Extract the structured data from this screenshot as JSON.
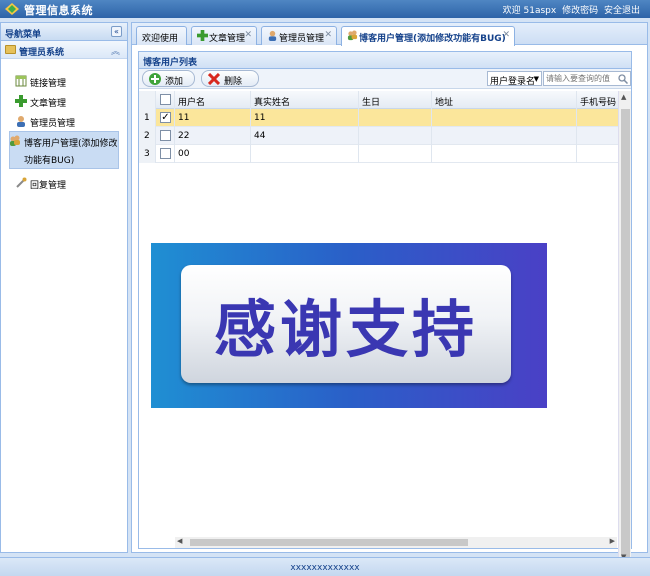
{
  "header": {
    "title": "管理信息系统",
    "welcome": "欢迎 51aspx",
    "change_password": "修改密码",
    "logout": "安全退出",
    "logo_icon": "app-logo-icon"
  },
  "sidebar": {
    "panel_title": "导航菜单",
    "group_title": "管理员系统",
    "items": [
      {
        "label": "链接管理",
        "icon": "link-grid-icon"
      },
      {
        "label": "文章管理",
        "icon": "green-plus-icon"
      },
      {
        "label": "管理员管理",
        "icon": "user-icon"
      },
      {
        "label": "博客用户管理(添加修改功能有BUG)",
        "icon": "users-icon"
      },
      {
        "label": "回复管理",
        "icon": "wrench-icon"
      }
    ]
  },
  "tabs": [
    {
      "label": "欢迎使用"
    },
    {
      "label": "文章管理"
    },
    {
      "label": "管理员管理"
    },
    {
      "label": "博客用户管理(添加修改功能有BUG)"
    }
  ],
  "grid": {
    "title": "博客用户列表",
    "add_label": "添加",
    "delete_label": "删除",
    "search_field": "用户登录名",
    "search_placeholder": "请输入要查询的值",
    "columns": [
      "用户名",
      "真实姓名",
      "生日",
      "地址",
      "手机号码"
    ],
    "rows": [
      {
        "num": "1",
        "checked": "✓",
        "username": "11",
        "realname": "11",
        "birthday": "",
        "address": "",
        "phone": ""
      },
      {
        "num": "2",
        "checked": "",
        "username": "22",
        "realname": "44",
        "birthday": "",
        "address": "",
        "phone": ""
      },
      {
        "num": "3",
        "checked": "",
        "username": "00",
        "realname": "",
        "birthday": "",
        "address": "",
        "phone": ""
      }
    ]
  },
  "banner": {
    "text": "感谢支持"
  },
  "footer": {
    "text": "xxxxxxxxxxxxx"
  },
  "colors": {
    "header": "#2d63a8",
    "selected_row": "#fbe69b",
    "banner_text": "#3a37b2"
  }
}
